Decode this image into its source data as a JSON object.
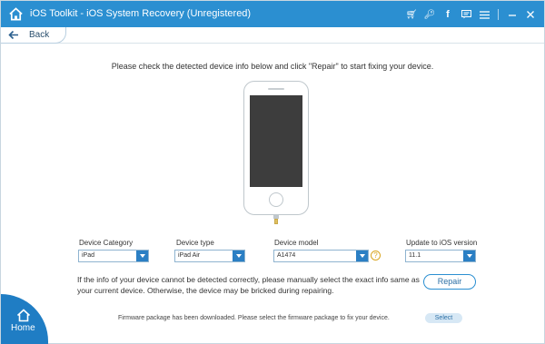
{
  "window": {
    "title": "iOS Toolkit - iOS System Recovery (Unregistered)",
    "accent": "#2b8fd1"
  },
  "titlebar_icons": [
    "cart-icon",
    "key-icon",
    "facebook-icon",
    "feedback-icon",
    "menu-icon",
    "minimize-icon",
    "close-icon"
  ],
  "nav": {
    "back_label": "Back",
    "home_label": "Home"
  },
  "instruction": "Please check the detected device info below and click \"Repair\" to start fixing your device.",
  "fields": {
    "category": {
      "label": "Device Category",
      "value": "iPad"
    },
    "type": {
      "label": "Device type",
      "value": "iPad Air"
    },
    "model": {
      "label": "Device model",
      "value": "A1474"
    },
    "ios": {
      "label": "Update to iOS version",
      "value": "11.1"
    }
  },
  "note": "If the info of your device cannot be detected correctly, please manually select the exact info same as your current device. Otherwise, the device may be bricked during repairing.",
  "repair_label": "Repair",
  "firmware": {
    "text": "Firmware package has been downloaded. Please select the firmware package to fix your device.",
    "select_label": "Select"
  }
}
